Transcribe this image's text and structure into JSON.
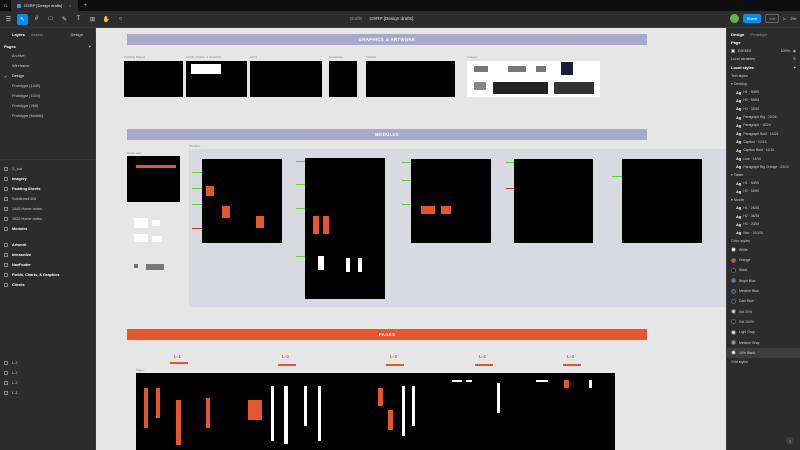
{
  "tabbar": {
    "tab_title": "GSRP [Design drafts]"
  },
  "toolbar": {
    "breadcrumb_project": "Drafts",
    "breadcrumb_file": "GSRP [Design drafts]",
    "share_label": "Share",
    "code_label": "</>",
    "zoom": "2%"
  },
  "left": {
    "tabs": {
      "layers": "Layers",
      "assets": "Assets",
      "design": "Design"
    },
    "pages_title": "Pages",
    "pages": [
      {
        "label": "Archive"
      },
      {
        "label": "Wireframe"
      },
      {
        "label": "Design"
      },
      {
        "label": "Prototype (1440)"
      },
      {
        "label": "Prototype (1024)"
      },
      {
        "label": "Prototype (768)"
      },
      {
        "label": "Prototype (Mobile)"
      }
    ],
    "layers": [
      {
        "label": "X_out"
      },
      {
        "label": "Imagery"
      },
      {
        "label": "Padding Sheets"
      },
      {
        "label": "Solutions1428"
      },
      {
        "label": "1448 Home notes"
      },
      {
        "label": "1028 Home notes"
      },
      {
        "label": "Modules"
      },
      {
        "label": "Artwork"
      },
      {
        "label": "Interactive"
      },
      {
        "label": "NavFooter"
      },
      {
        "label": "Fields, Charts, & Graphics"
      },
      {
        "label": "Clients"
      },
      {
        "label": "L-3"
      },
      {
        "label": "L-2"
      },
      {
        "label": "L-2"
      },
      {
        "label": "L-1"
      }
    ]
  },
  "canvas": {
    "band1": "GRAPHICS & ARTWORK",
    "band2": "MODULES",
    "band3": "PAGES",
    "frame_labels": {
      "padding": "Padding Sheets",
      "fields": "Fields, Charts, & Graphics",
      "icons": "Icons",
      "interactive": "Interactive",
      "artwork": "Artwork",
      "imagery": "Imagery",
      "navfooter": "NavFooter",
      "modules": "Modules",
      "pages": "Pages"
    },
    "page_levels": [
      "L-1",
      "L-2",
      "L-3",
      "L-2",
      "L-3"
    ]
  },
  "right": {
    "tabs": {
      "design": "Design",
      "prototype": "Prototype"
    },
    "page_title": "Page",
    "page_color": "E6E6E6",
    "page_opacity": "100%",
    "local_variables": "Local variables",
    "local_styles": "Local styles",
    "text_styles": "Text styles",
    "groups": {
      "desktop": "Desktop",
      "tablet": "Tablet",
      "mobile": "Mobile"
    },
    "desktop_styles": [
      {
        "ag": "Ag",
        "label": "H1 · 80/90"
      },
      {
        "ag": "Ag",
        "label": "H2 · 56/64"
      },
      {
        "ag": "Ag",
        "label": "H3 · 32/40"
      },
      {
        "ag": "Ag",
        "label": "Paragraph Big · 20/24"
      },
      {
        "ag": "Ag",
        "label": "Paragraph · 16/24"
      },
      {
        "ag": "Ag",
        "label": "Paragraph Bold · 16/24"
      },
      {
        "ag": "Ag",
        "label": "Caption · 12/16"
      },
      {
        "ag": "Ag",
        "label": "Caption Bold · 12/16"
      },
      {
        "ag": "Ag",
        "label": "Link · 14/16"
      },
      {
        "ag": "Ag",
        "label": "Paragraph Big Orange · 20/24"
      }
    ],
    "tablet_styles": [
      {
        "ag": "Ag",
        "label": "H1 · 80/90"
      },
      {
        "ag": "Ag",
        "label": "H2 · 52/60"
      }
    ],
    "mobile_styles": [
      {
        "ag": "Ag",
        "label": "H1 · 24/28"
      },
      {
        "ag": "Ag",
        "label": "H2 · 36/38"
      },
      {
        "ag": "Ag",
        "label": "H3 · 20/24"
      },
      {
        "ag": "Ag",
        "label": "Nav · 10/100"
      }
    ],
    "color_styles_title": "Color styles",
    "colors": [
      {
        "label": "White",
        "hex": "#ffffff"
      },
      {
        "label": "Orange",
        "hex": "#e4572e"
      },
      {
        "label": "Black",
        "hex": "#000000"
      },
      {
        "label": "Bright Blue",
        "hex": "#3b82f6"
      },
      {
        "label": "Medium Blue",
        "hex": "#1e4fa8"
      },
      {
        "label": "Dark Blue",
        "hex": "#0f2a5e"
      },
      {
        "label": "Gst 20%",
        "hex": "#cccccc"
      },
      {
        "label": "Gst 100%",
        "hex": "#1a1a1a"
      },
      {
        "label": "Light Gray",
        "hex": "#e6e6e6"
      },
      {
        "label": "Medium Gray",
        "hex": "#9a9a9a"
      },
      {
        "label": "10% Black",
        "hex": "#e5e5e5"
      }
    ],
    "colors_tail": "Grid styles"
  }
}
